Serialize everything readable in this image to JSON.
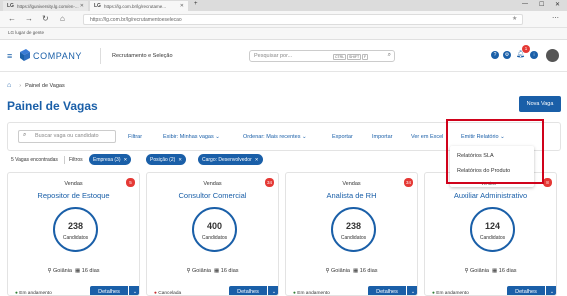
{
  "browser": {
    "tabs": [
      {
        "favicon": "LG",
        "label": "https://lguniversity.lg.com/en-..."
      },
      {
        "favicon": "LG",
        "label": "https://lg.com.br/lg/recrutame..."
      }
    ],
    "url": "https://lg.com.br/lg/recrutamentoeselecao",
    "bookmark": "LG lugar de gente"
  },
  "header": {
    "brand": "COMPANY",
    "module": "Recrutamento e Seleção",
    "search_placeholder": "Pesquisar por...",
    "shortcut_keys": [
      "CTRL",
      "SHIFT",
      "F"
    ],
    "notification_count": "1"
  },
  "breadcrumb": {
    "items": [
      "Painel de Vagas"
    ]
  },
  "page": {
    "title": "Painel de Vagas",
    "new_button": "Nova Vaga"
  },
  "toolbar": {
    "search_placeholder": "Buscar vaga ou candidato",
    "filter": "Filtrar",
    "show": "Exibir: Minhas vagas",
    "sort": "Ordenar: Mais recentes",
    "export": "Exportar",
    "import": "Importar",
    "view_excel": "Ver em Excel",
    "report": "Emitir Relatório"
  },
  "filters": {
    "count": "5 Vagas encontradas",
    "label": "Filtros",
    "chips": [
      "Empresa (3)",
      "Posição (2)",
      "Cargo: Desenvolvedor"
    ]
  },
  "report_menu": {
    "items": [
      "Relatórios SLA",
      "Relatórios do Produto"
    ],
    "partial_label": "Vendas"
  },
  "cards": [
    {
      "dept": "Vendas",
      "title": "Repositor de Estoque",
      "badge": "5",
      "count": "238",
      "unit": "Candidatos",
      "city": "Goiânia",
      "days": "16 dias",
      "status": "Em andamento",
      "details": "Detalhes"
    },
    {
      "dept": "Vendas",
      "title": "Consultor Comercial",
      "badge": "34",
      "count": "400",
      "unit": "Candidatos",
      "city": "Goiânia",
      "days": "16 dias",
      "status": "Cancelada",
      "details": "Detalhes"
    },
    {
      "dept": "Vendas",
      "title": "Analista de RH",
      "badge": "34",
      "count": "238",
      "unit": "Candidatos",
      "city": "Goiânia",
      "days": "16 dias",
      "status": "Em andamento",
      "details": "Detalhes"
    },
    {
      "dept": "Vendas",
      "title": "Auxiliar Administrativo",
      "badge": "8",
      "count": "124",
      "unit": "Candidatos",
      "city": "Goiânia",
      "days": "16 dias",
      "status": "Em andamento",
      "details": "Detalhes"
    }
  ],
  "colors": {
    "primary": "#1a5fa8",
    "danger": "#e53935",
    "highlight": "#d0021b"
  }
}
